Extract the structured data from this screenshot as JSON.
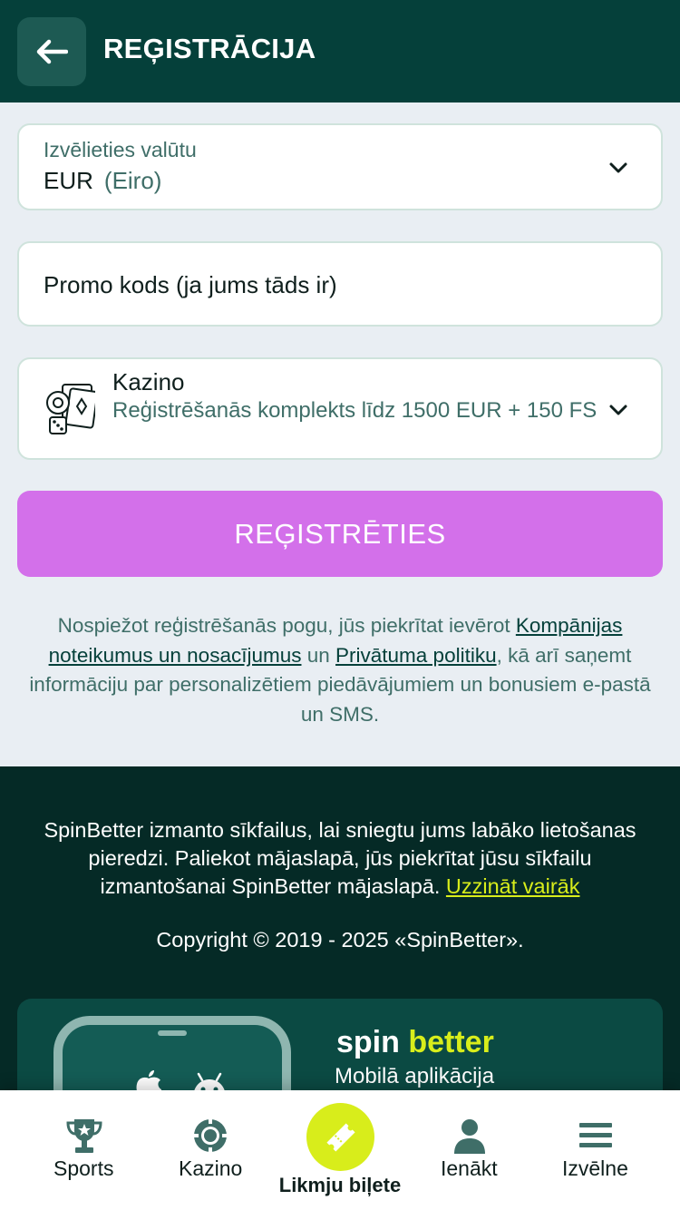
{
  "header": {
    "title": "REĢISTRĀCIJA"
  },
  "currency": {
    "label": "Izvēlieties valūtu",
    "code": "EUR",
    "name": "(Eiro)"
  },
  "promo": {
    "placeholder": "Promo kods (ja jums tāds ir)"
  },
  "bonus": {
    "title": "Kazino",
    "description": "Reģistrēšanās komplekts līdz 1500 EUR + 150 FS",
    "icon": "casino-cards-dice-icon"
  },
  "register_button": "REĢISTRĒTIES",
  "terms": {
    "text_1": "Nospiežot reģistrēšanās pogu, jūs piekrītat ievērot ",
    "link_1": "Kompānijas noteikumus un nosacījumus",
    "text_2": " un ",
    "link_2": "Privātuma politiku",
    "text_3": ", kā arī saņemt informāciju par personalizētiem piedāvājumiem un bonusiem e-pastā un SMS."
  },
  "footer": {
    "cookie_text": "SpinBetter izmanto sīkfailus, lai sniegtu jums labāko lietošanas pieredzi. Paliekot mājaslapā, jūs piekrītat jūsu sīkfailu izmantošanai SpinBetter mājaslapā. ",
    "cookie_link": "Uzzināt vairāk",
    "copyright": "Copyright © 2019 - 2025 «SpinBetter».",
    "app": {
      "brand_spin": "spin",
      "brand_better": "better",
      "label": "Mobilā aplikācija"
    }
  },
  "nav": {
    "sports": "Sports",
    "casino": "Kazino",
    "betslip": "Likmju biļete",
    "login": "Ienākt",
    "menu": "Izvēlne"
  },
  "colors": {
    "header_bg": "#05403a",
    "register_button": "#d370ea",
    "footer_bg": "#052a26",
    "accent_lime": "#d8ed1b",
    "muted_text": "#3f6e68"
  }
}
